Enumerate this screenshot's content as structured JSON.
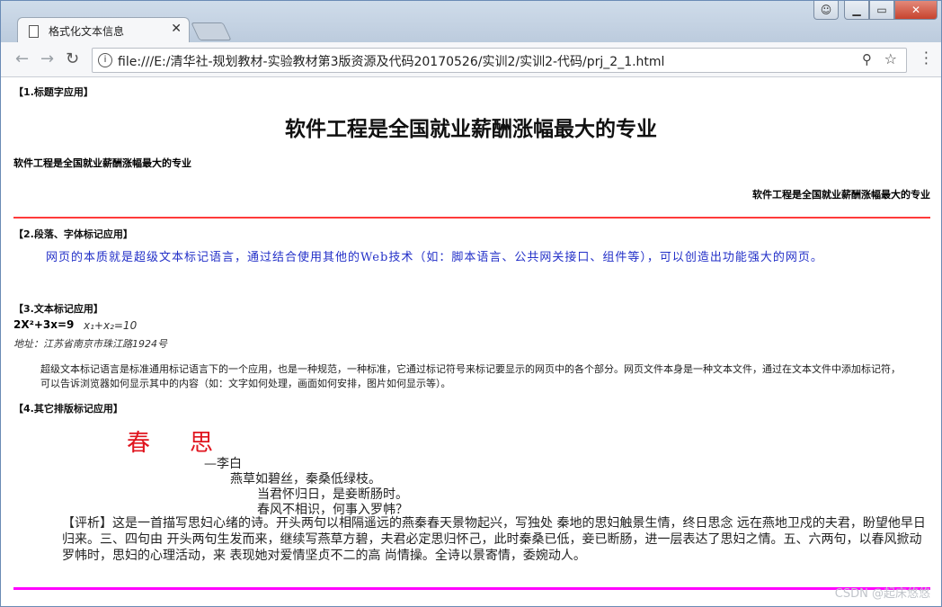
{
  "browser": {
    "tab_title": "格式化文本信息",
    "url": "file:///E:/清华社-规划教材-实验教材第3版资源及代码20170526/实训2/实训2-代码/prj_2_1.html"
  },
  "page": {
    "section1": "【1.标题字应用】",
    "heading_large": "软件工程是全国就业薪酬涨幅最大的专业",
    "heading_small_left": "软件工程是全国就业薪酬涨幅最大的专业",
    "heading_small_right": "软件工程是全国就业薪酬涨幅最大的专业",
    "section2": "【2.段落、字体标记应用】",
    "paragraph": "网页的本质就是超级文本标记语言，通过结合使用其他的Web技术（如：脚本语言、公共网关接口、组件等），可以创造出功能强大的网页。",
    "section3": "【3.文本标记应用】",
    "formula1": "2X²+3x=9",
    "formula2": "x₁+x₂=10",
    "address": "地址：江苏省南京市珠江路1924号",
    "blockquote": "超级文本标记语言是标准通用标记语言下的一个应用，也是一种规范，一种标准，它通过标记符号来标记要显示的网页中的各个部分。网页文件本身是一种文本文件，通过在文本文件中添加标记符，可以告诉浏览器如何显示其中的内容（如：文字如何处理，画面如何安排，图片如何显示等）。",
    "section4": "【4.其它排版标记应用】",
    "poem_title": "春思",
    "poem_author": "—李白",
    "poem_line1": "燕草如碧丝，秦桑低绿枝。",
    "poem_line2": "当君怀归日，是妾断肠时。",
    "poem_line3": "春风不相识，何事入罗帏？",
    "commentary": "【评析】这是一首描写思妇心绪的诗。开头两句以相隔遥远的燕秦春天景物起兴，写独处 秦地的思妇触景生情，终日思念 远在燕地卫戍的夫君，盼望他早日归来。三、四句由 开头两句生发而来，继续写燕草方碧，夫君必定思归怀己，此时秦桑已低，妾已断肠，进一层表达了思妇之情。五、六两句，以春风掀动罗帏时，思妇的心理活动，来 表现她对爱情坚贞不二的高 尚情操。全诗以景寄情，委婉动人。",
    "watermark": "CSDN @起床悠悠"
  },
  "colors": {
    "red_rule": "#ff3b3b",
    "magenta_rule": "#ff00ff",
    "paragraph_text": "#2330c8",
    "poem_title": "#e0141e"
  }
}
